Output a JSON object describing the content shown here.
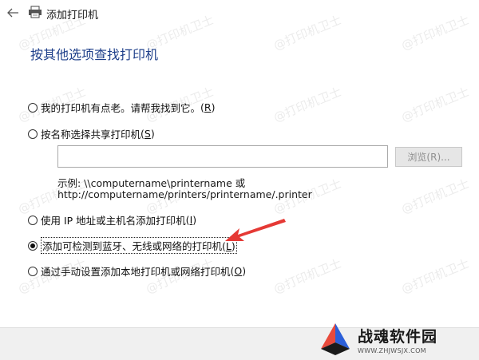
{
  "window": {
    "title": "添加打印机",
    "back_icon": "back-arrow-icon",
    "printer_icon": "printer-icon"
  },
  "heading": "按其他选项查找打印机",
  "options": [
    {
      "label": "我的打印机有点老。请帮我找到它。",
      "accel": "R",
      "checked": false
    },
    {
      "label": "按名称选择共享打印机",
      "accel": "S",
      "checked": false
    },
    {
      "label": "使用 IP 地址或主机名添加打印机",
      "accel": "I",
      "checked": false
    },
    {
      "label": "添加可检测到蓝牙、无线或网络的打印机",
      "accel": "L",
      "checked": true
    },
    {
      "label": "通过手动设置添加本地打印机或网络打印机",
      "accel": "O",
      "checked": false
    }
  ],
  "shared_printer": {
    "input_value": "",
    "browse_label": "浏览(R)...",
    "example_line1": "示例: \\\\computername\\printername 或",
    "example_line2": "http://computername/printers/printername/.printer"
  },
  "watermark": "@打印机卫士",
  "brand": {
    "name": "战魂软件园",
    "url": "WWW.ZHJWSJX.COM"
  },
  "colors": {
    "heading": "#1e3f8a",
    "arrow": "#e53935",
    "footer": "#f0f0f0",
    "logo_red": "#e84a3c",
    "logo_blue": "#2b5fd9"
  }
}
